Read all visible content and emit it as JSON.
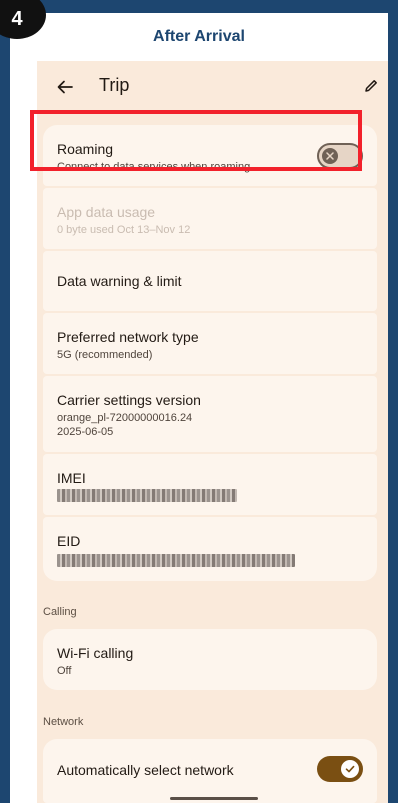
{
  "step": {
    "number": "4",
    "title": "After Arrival"
  },
  "topbar": {
    "title": "Trip"
  },
  "rows": {
    "roaming": {
      "title": "Roaming",
      "subtitle": "Connect to data services when roaming"
    },
    "app_data_usage": {
      "title": "App data usage",
      "subtitle": "0 byte used Oct 13–Nov 12"
    },
    "data_warning": {
      "title": "Data warning & limit"
    },
    "preferred_network": {
      "title": "Preferred network type",
      "subtitle": "5G (recommended)"
    },
    "carrier_settings": {
      "title": "Carrier settings version",
      "line1": "orange_pl-72000000016.24",
      "line2": "2025-06-05"
    },
    "imei": {
      "title": "IMEI"
    },
    "eid": {
      "title": "EID"
    },
    "wifi_calling": {
      "title": "Wi-Fi calling",
      "subtitle": "Off"
    },
    "auto_network": {
      "title": "Automatically select network"
    }
  },
  "sections": {
    "calling": "Calling",
    "network": "Network"
  },
  "toggles": {
    "roaming": false,
    "auto_network": true
  },
  "colors": {
    "highlight": "#f2212b",
    "toggle_on": "#7a4f12",
    "background": "#1d4670"
  }
}
